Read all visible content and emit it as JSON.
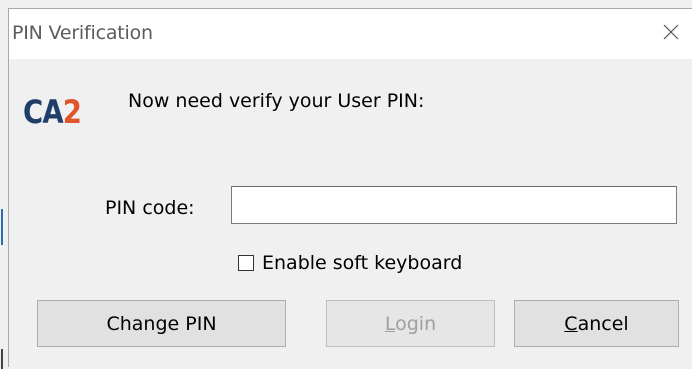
{
  "window": {
    "title": "PIN Verification",
    "close_icon": "close-icon"
  },
  "logo": {
    "part1": "CA",
    "part2": "2",
    "colors": {
      "primary": "#1f3f6a",
      "accent": "#e0542a"
    }
  },
  "prompt": "Now need verify your User PIN:",
  "pin": {
    "label": "PIN code:",
    "value": ""
  },
  "soft_keyboard": {
    "label": "Enable soft keyboard",
    "checked": false
  },
  "buttons": {
    "change_pin": "Change PIN",
    "login": {
      "mnemonic": "L",
      "rest": "ogin",
      "enabled": false
    },
    "cancel": {
      "mnemonic": "C",
      "rest": "ancel"
    }
  }
}
